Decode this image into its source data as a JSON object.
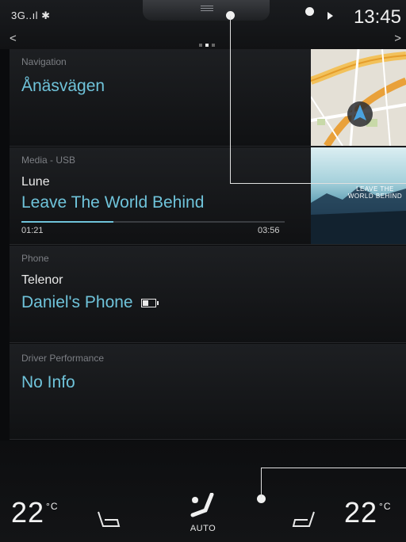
{
  "status": {
    "signal": "3G..ıl ✱",
    "time": "13:45"
  },
  "tiles": {
    "navigation": {
      "label": "Navigation",
      "destination": "Ånäsvägen"
    },
    "media": {
      "label": "Media - USB",
      "artist": "Lune",
      "track": "Leave The World Behind",
      "elapsed": "01:21",
      "duration": "03:56",
      "progress": 0.35,
      "album_text": "LEAVE THE WORLD BEHIND"
    },
    "phone": {
      "label": "Phone",
      "carrier": "Telenor",
      "device": "Daniel's Phone"
    },
    "driver": {
      "label": "Driver Performance",
      "value": "No Info"
    }
  },
  "climate": {
    "left_temp": "22",
    "right_temp": "22",
    "unit": "°C",
    "mode": "AUTO"
  },
  "colors": {
    "accent": "#6fc3da"
  }
}
